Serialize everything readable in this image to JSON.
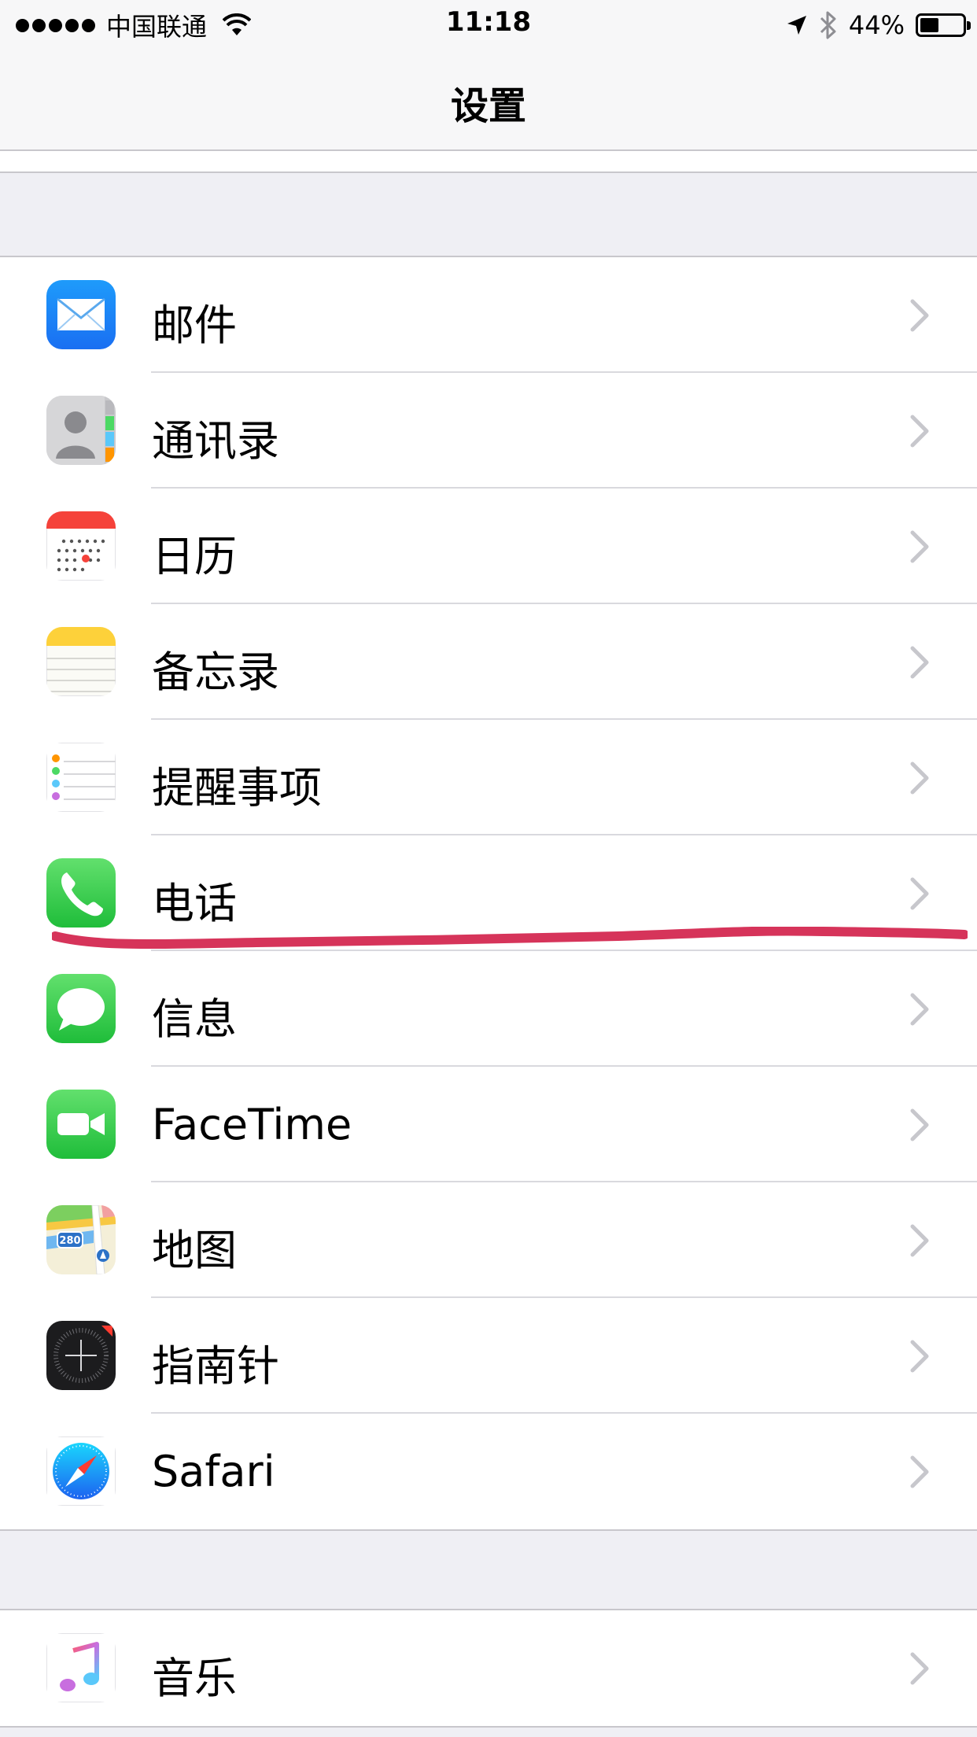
{
  "status_bar": {
    "carrier": "中国联通",
    "time": "11:18",
    "battery_percent": "44%",
    "battery_level": 0.44
  },
  "nav": {
    "title": "设置"
  },
  "groups": [
    {
      "items": [
        {
          "label": "邮件",
          "icon": "mail-icon"
        },
        {
          "label": "通讯录",
          "icon": "contacts-icon"
        },
        {
          "label": "日历",
          "icon": "calendar-icon"
        },
        {
          "label": "备忘录",
          "icon": "notes-icon"
        },
        {
          "label": "提醒事项",
          "icon": "reminders-icon"
        },
        {
          "label": "电话",
          "icon": "phone-icon"
        },
        {
          "label": "信息",
          "icon": "messages-icon"
        },
        {
          "label": "FaceTime",
          "icon": "facetime-icon"
        },
        {
          "label": "地图",
          "icon": "maps-icon"
        },
        {
          "label": "指南针",
          "icon": "compass-icon"
        },
        {
          "label": "Safari",
          "icon": "safari-icon"
        }
      ]
    },
    {
      "items": [
        {
          "label": "音乐",
          "icon": "music-icon"
        }
      ]
    }
  ],
  "maps_icon_text": "280",
  "colors": {
    "accent_annotation": "#d6345a",
    "background": "#efeff4",
    "separator": "#c8c7cc",
    "chevron": "#c7c7cc"
  }
}
